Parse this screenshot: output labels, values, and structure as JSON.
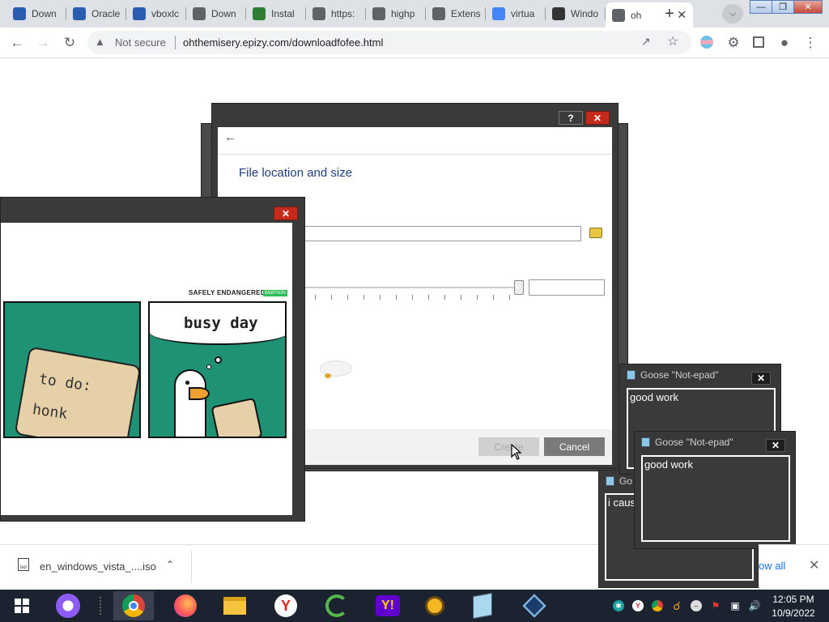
{
  "browser": {
    "tabs": [
      {
        "label": "Down",
        "favicon": "virtualbox-icon",
        "color": "#2a5db0"
      },
      {
        "label": "Oracle",
        "favicon": "virtualbox-icon",
        "color": "#2a5db0"
      },
      {
        "label": "vboxlc",
        "favicon": "virtualbox-icon",
        "color": "#2a5db0"
      },
      {
        "label": "Down",
        "favicon": "globe-icon",
        "color": "#5f6368"
      },
      {
        "label": "Instal",
        "favicon": "download-icon",
        "color": "#2e7d32"
      },
      {
        "label": "https:",
        "favicon": "globe-icon",
        "color": "#5f6368"
      },
      {
        "label": "highp",
        "favicon": "globe-icon",
        "color": "#5f6368"
      },
      {
        "label": "Extens",
        "favicon": "puzzle-icon",
        "color": "#5f6368"
      },
      {
        "label": "virtua",
        "favicon": "google-icon",
        "color": "#4285f4"
      },
      {
        "label": "Windo",
        "favicon": "building-icon",
        "color": "#333333"
      },
      {
        "label": "oh",
        "favicon": "globe-icon",
        "color": "#5f6368",
        "active": true
      }
    ],
    "new_tab_symbol": "+",
    "security_label": "Not secure",
    "url": "ohthemisery.epizy.com/downloadfofee.html"
  },
  "vbox_dialog": {
    "help_symbol": "?",
    "close_symbol": "✕",
    "back_symbol": "←",
    "heading": "File location and size",
    "create_label": "Create",
    "cancel_label": "Cancel"
  },
  "comic_window": {
    "close_symbol": "✕",
    "brand": "SAFELY ENDANGERED",
    "brand_url": "WEBTOON",
    "panel1_text1": "to do:",
    "panel1_text2": "honk",
    "panel2_title": "busy day"
  },
  "notes": [
    {
      "title": "Goose \"Not-epad\"",
      "text": "good work"
    },
    {
      "title": "Goose \"Not-epad\"",
      "text": "good work"
    },
    {
      "title": "Go",
      "text": "i caus"
    }
  ],
  "downloads": {
    "filename": "en_windows_vista_....iso",
    "show_all": "ow all"
  },
  "taskbar": {
    "time": "12:05 PM",
    "date": "10/9/2022"
  }
}
